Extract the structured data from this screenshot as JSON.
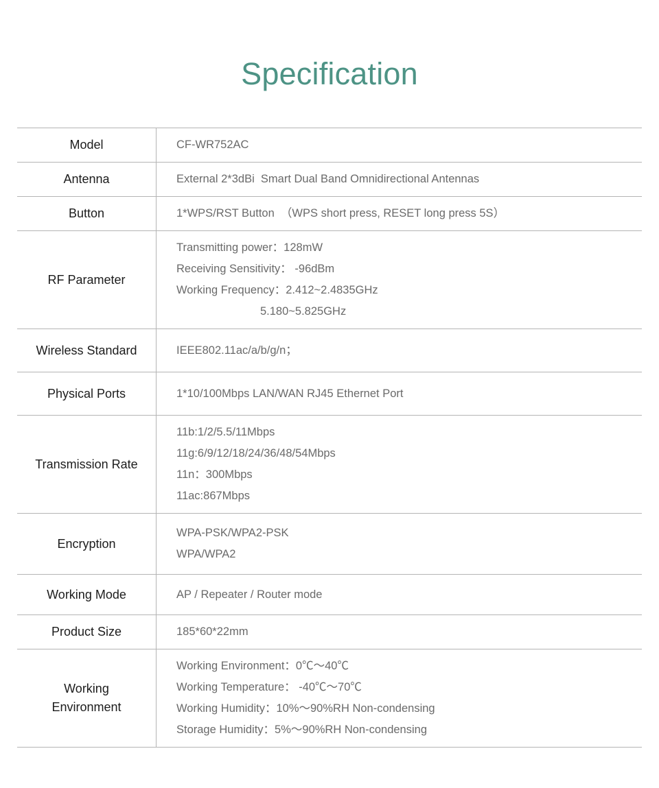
{
  "title": "Specification",
  "title_color": "#4d9385",
  "table": {
    "rows": [
      {
        "key": "model",
        "label": "Model",
        "lines": [
          "CF-WR752AC"
        ]
      },
      {
        "key": "antenna",
        "label": "Antenna",
        "lines": [
          "External 2*3dBi  Smart Dual Band Omnidirectional Antennas"
        ]
      },
      {
        "key": "button",
        "label": "Button",
        "lines": [
          "1*WPS/RST Button  （WPS short press, RESET long press 5S）"
        ]
      },
      {
        "key": "rf-parameter",
        "label": "RF Parameter",
        "lines": [
          "Transmitting power：128mW",
          "Receiving Sensitivity： -96dBm",
          "Working Frequency：2.412~2.4835GHz",
          "5.180~5.825GHz"
        ],
        "indent_lines": [
          3
        ]
      },
      {
        "key": "wireless-standard",
        "label": "Wireless Standard",
        "lines": [
          "IEEE802.11ac/a/b/g/n；"
        ]
      },
      {
        "key": "physical-ports",
        "label": "Physical Ports",
        "lines": [
          "1*10/100Mbps LAN/WAN RJ45 Ethernet Port"
        ]
      },
      {
        "key": "transmission-rate",
        "label": "Transmission Rate",
        "lines": [
          "11b:1/2/5.5/11Mbps",
          "11g:6/9/12/18/24/36/48/54Mbps",
          "11n：300Mbps",
          "11ac:867Mbps"
        ]
      },
      {
        "key": "encryption",
        "label": "Encryption",
        "lines": [
          "WPA-PSK/WPA2-PSK",
          "WPA/WPA2"
        ]
      },
      {
        "key": "working-mode",
        "label": "Working Mode",
        "lines": [
          "AP / Repeater / Router mode"
        ]
      },
      {
        "key": "product-size",
        "label": "Product Size",
        "lines": [
          "185*60*22mm"
        ]
      },
      {
        "key": "working-environment",
        "label": "Working Environment",
        "label_lines": [
          "Working",
          "Environment"
        ],
        "lines": [
          "Working Environment：0℃〜40℃",
          "Working Temperature： -40℃〜70℃",
          "Working Humidity：10%〜90%RH Non-condensing",
          "Storage Humidity：5%〜90%RH Non-condensing"
        ]
      }
    ]
  }
}
